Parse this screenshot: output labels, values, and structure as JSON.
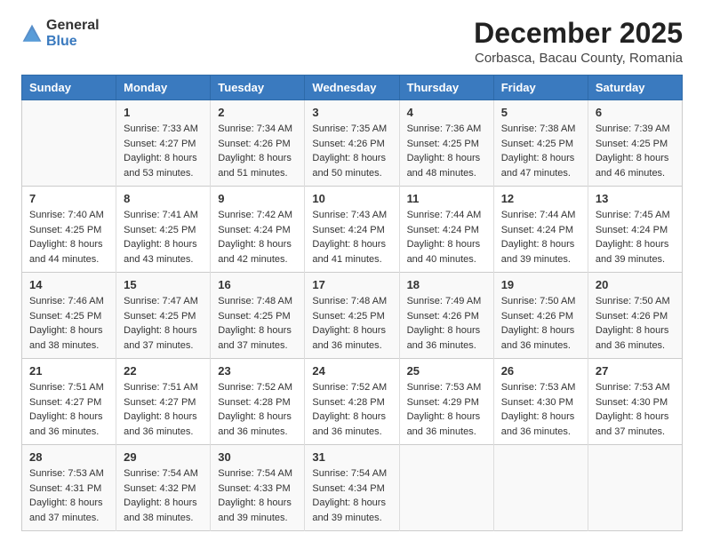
{
  "logo": {
    "text_general": "General",
    "text_blue": "Blue"
  },
  "header": {
    "title": "December 2025",
    "subtitle": "Corbasca, Bacau County, Romania"
  },
  "days_of_week": [
    "Sunday",
    "Monday",
    "Tuesday",
    "Wednesday",
    "Thursday",
    "Friday",
    "Saturday"
  ],
  "weeks": [
    [
      {
        "day": "",
        "sunrise": "",
        "sunset": "",
        "daylight": ""
      },
      {
        "day": "1",
        "sunrise": "Sunrise: 7:33 AM",
        "sunset": "Sunset: 4:27 PM",
        "daylight": "Daylight: 8 hours and 53 minutes."
      },
      {
        "day": "2",
        "sunrise": "Sunrise: 7:34 AM",
        "sunset": "Sunset: 4:26 PM",
        "daylight": "Daylight: 8 hours and 51 minutes."
      },
      {
        "day": "3",
        "sunrise": "Sunrise: 7:35 AM",
        "sunset": "Sunset: 4:26 PM",
        "daylight": "Daylight: 8 hours and 50 minutes."
      },
      {
        "day": "4",
        "sunrise": "Sunrise: 7:36 AM",
        "sunset": "Sunset: 4:25 PM",
        "daylight": "Daylight: 8 hours and 48 minutes."
      },
      {
        "day": "5",
        "sunrise": "Sunrise: 7:38 AM",
        "sunset": "Sunset: 4:25 PM",
        "daylight": "Daylight: 8 hours and 47 minutes."
      },
      {
        "day": "6",
        "sunrise": "Sunrise: 7:39 AM",
        "sunset": "Sunset: 4:25 PM",
        "daylight": "Daylight: 8 hours and 46 minutes."
      }
    ],
    [
      {
        "day": "7",
        "sunrise": "Sunrise: 7:40 AM",
        "sunset": "Sunset: 4:25 PM",
        "daylight": "Daylight: 8 hours and 44 minutes."
      },
      {
        "day": "8",
        "sunrise": "Sunrise: 7:41 AM",
        "sunset": "Sunset: 4:25 PM",
        "daylight": "Daylight: 8 hours and 43 minutes."
      },
      {
        "day": "9",
        "sunrise": "Sunrise: 7:42 AM",
        "sunset": "Sunset: 4:24 PM",
        "daylight": "Daylight: 8 hours and 42 minutes."
      },
      {
        "day": "10",
        "sunrise": "Sunrise: 7:43 AM",
        "sunset": "Sunset: 4:24 PM",
        "daylight": "Daylight: 8 hours and 41 minutes."
      },
      {
        "day": "11",
        "sunrise": "Sunrise: 7:44 AM",
        "sunset": "Sunset: 4:24 PM",
        "daylight": "Daylight: 8 hours and 40 minutes."
      },
      {
        "day": "12",
        "sunrise": "Sunrise: 7:44 AM",
        "sunset": "Sunset: 4:24 PM",
        "daylight": "Daylight: 8 hours and 39 minutes."
      },
      {
        "day": "13",
        "sunrise": "Sunrise: 7:45 AM",
        "sunset": "Sunset: 4:24 PM",
        "daylight": "Daylight: 8 hours and 39 minutes."
      }
    ],
    [
      {
        "day": "14",
        "sunrise": "Sunrise: 7:46 AM",
        "sunset": "Sunset: 4:25 PM",
        "daylight": "Daylight: 8 hours and 38 minutes."
      },
      {
        "day": "15",
        "sunrise": "Sunrise: 7:47 AM",
        "sunset": "Sunset: 4:25 PM",
        "daylight": "Daylight: 8 hours and 37 minutes."
      },
      {
        "day": "16",
        "sunrise": "Sunrise: 7:48 AM",
        "sunset": "Sunset: 4:25 PM",
        "daylight": "Daylight: 8 hours and 37 minutes."
      },
      {
        "day": "17",
        "sunrise": "Sunrise: 7:48 AM",
        "sunset": "Sunset: 4:25 PM",
        "daylight": "Daylight: 8 hours and 36 minutes."
      },
      {
        "day": "18",
        "sunrise": "Sunrise: 7:49 AM",
        "sunset": "Sunset: 4:26 PM",
        "daylight": "Daylight: 8 hours and 36 minutes."
      },
      {
        "day": "19",
        "sunrise": "Sunrise: 7:50 AM",
        "sunset": "Sunset: 4:26 PM",
        "daylight": "Daylight: 8 hours and 36 minutes."
      },
      {
        "day": "20",
        "sunrise": "Sunrise: 7:50 AM",
        "sunset": "Sunset: 4:26 PM",
        "daylight": "Daylight: 8 hours and 36 minutes."
      }
    ],
    [
      {
        "day": "21",
        "sunrise": "Sunrise: 7:51 AM",
        "sunset": "Sunset: 4:27 PM",
        "daylight": "Daylight: 8 hours and 36 minutes."
      },
      {
        "day": "22",
        "sunrise": "Sunrise: 7:51 AM",
        "sunset": "Sunset: 4:27 PM",
        "daylight": "Daylight: 8 hours and 36 minutes."
      },
      {
        "day": "23",
        "sunrise": "Sunrise: 7:52 AM",
        "sunset": "Sunset: 4:28 PM",
        "daylight": "Daylight: 8 hours and 36 minutes."
      },
      {
        "day": "24",
        "sunrise": "Sunrise: 7:52 AM",
        "sunset": "Sunset: 4:28 PM",
        "daylight": "Daylight: 8 hours and 36 minutes."
      },
      {
        "day": "25",
        "sunrise": "Sunrise: 7:53 AM",
        "sunset": "Sunset: 4:29 PM",
        "daylight": "Daylight: 8 hours and 36 minutes."
      },
      {
        "day": "26",
        "sunrise": "Sunrise: 7:53 AM",
        "sunset": "Sunset: 4:30 PM",
        "daylight": "Daylight: 8 hours and 36 minutes."
      },
      {
        "day": "27",
        "sunrise": "Sunrise: 7:53 AM",
        "sunset": "Sunset: 4:30 PM",
        "daylight": "Daylight: 8 hours and 37 minutes."
      }
    ],
    [
      {
        "day": "28",
        "sunrise": "Sunrise: 7:53 AM",
        "sunset": "Sunset: 4:31 PM",
        "daylight": "Daylight: 8 hours and 37 minutes."
      },
      {
        "day": "29",
        "sunrise": "Sunrise: 7:54 AM",
        "sunset": "Sunset: 4:32 PM",
        "daylight": "Daylight: 8 hours and 38 minutes."
      },
      {
        "day": "30",
        "sunrise": "Sunrise: 7:54 AM",
        "sunset": "Sunset: 4:33 PM",
        "daylight": "Daylight: 8 hours and 39 minutes."
      },
      {
        "day": "31",
        "sunrise": "Sunrise: 7:54 AM",
        "sunset": "Sunset: 4:34 PM",
        "daylight": "Daylight: 8 hours and 39 minutes."
      },
      {
        "day": "",
        "sunrise": "",
        "sunset": "",
        "daylight": ""
      },
      {
        "day": "",
        "sunrise": "",
        "sunset": "",
        "daylight": ""
      },
      {
        "day": "",
        "sunrise": "",
        "sunset": "",
        "daylight": ""
      }
    ]
  ]
}
